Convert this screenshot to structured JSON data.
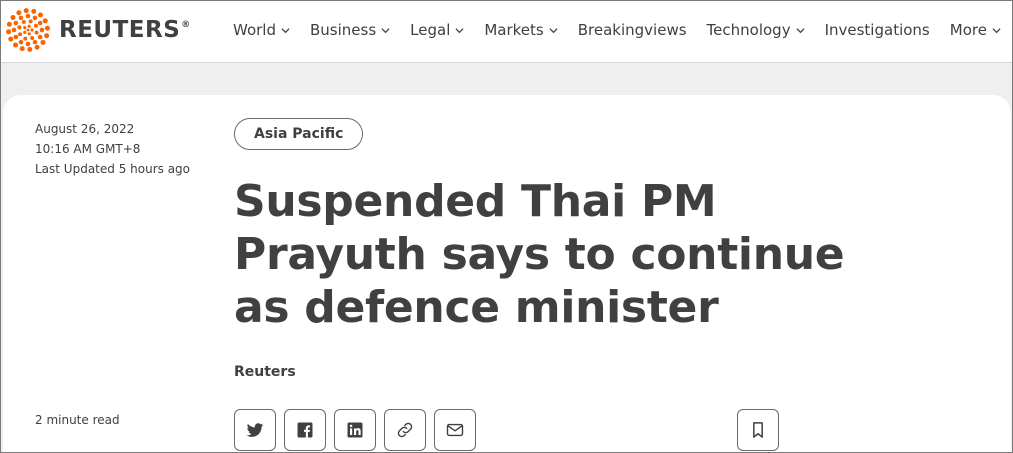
{
  "brand": {
    "name": "REUTERS",
    "registered_mark": "®",
    "accent_color": "#fa6400"
  },
  "nav": {
    "items": [
      {
        "label": "World",
        "has_dropdown": true
      },
      {
        "label": "Business",
        "has_dropdown": true
      },
      {
        "label": "Legal",
        "has_dropdown": true
      },
      {
        "label": "Markets",
        "has_dropdown": true
      },
      {
        "label": "Breakingviews",
        "has_dropdown": false
      },
      {
        "label": "Technology",
        "has_dropdown": true
      },
      {
        "label": "Investigations",
        "has_dropdown": false
      },
      {
        "label": "More",
        "has_dropdown": true
      }
    ]
  },
  "article": {
    "date": "August 26, 2022",
    "time": "10:16 AM GMT+8",
    "last_updated": "Last Updated 5 hours ago",
    "category": "Asia Pacific",
    "headline": "Suspended Thai PM Prayuth says to continue as defence minister",
    "byline": "Reuters",
    "read_time": "2 minute read"
  },
  "share": {
    "icons": [
      "twitter-icon",
      "facebook-icon",
      "linkedin-icon",
      "link-icon",
      "email-icon",
      "bookmark-icon"
    ]
  }
}
